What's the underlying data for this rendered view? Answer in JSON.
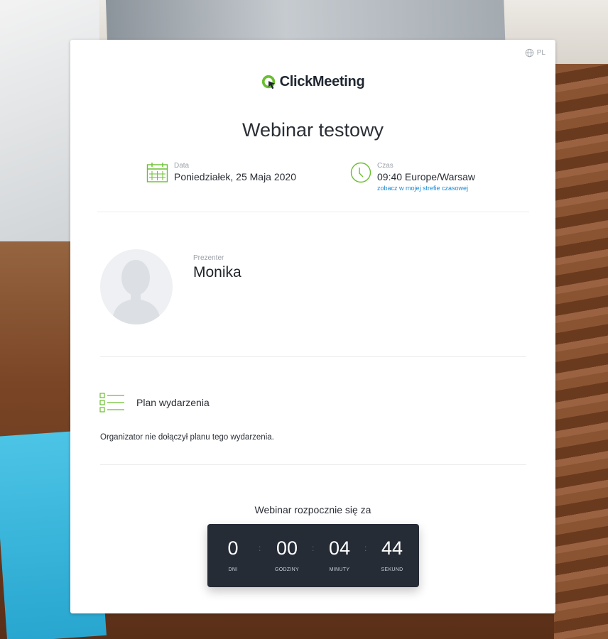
{
  "language": "PL",
  "brand": {
    "name": "ClickMeeting",
    "accent": "#6abf2f",
    "text_color": "#1f2630"
  },
  "event": {
    "title": "Webinar testowy",
    "date_label": "Data",
    "date_value": "Poniedziałek, 25 Maja 2020",
    "time_label": "Czas",
    "time_value": "09:40 Europe/Warsaw",
    "time_zone_link": "zobacz w mojej strefie czasowej"
  },
  "presenter": {
    "label": "Prezenter",
    "name": "Monika"
  },
  "agenda": {
    "title": "Plan wydarzenia",
    "description": "Organizator nie dołączył planu tego wydarzenia."
  },
  "countdown": {
    "label": "Webinar rozpocznie się za",
    "units": [
      {
        "value": "0",
        "label": "DNI"
      },
      {
        "value": "00",
        "label": "GODZINY"
      },
      {
        "value": "04",
        "label": "MINUTY"
      },
      {
        "value": "44",
        "label": "SEKUND"
      }
    ]
  },
  "icons": {
    "globe": "globe-icon",
    "logo": "clickmeeting-logo-icon",
    "calendar": "calendar-icon",
    "clock": "clock-icon",
    "avatar": "avatar-placeholder-icon",
    "agenda": "agenda-list-icon"
  }
}
